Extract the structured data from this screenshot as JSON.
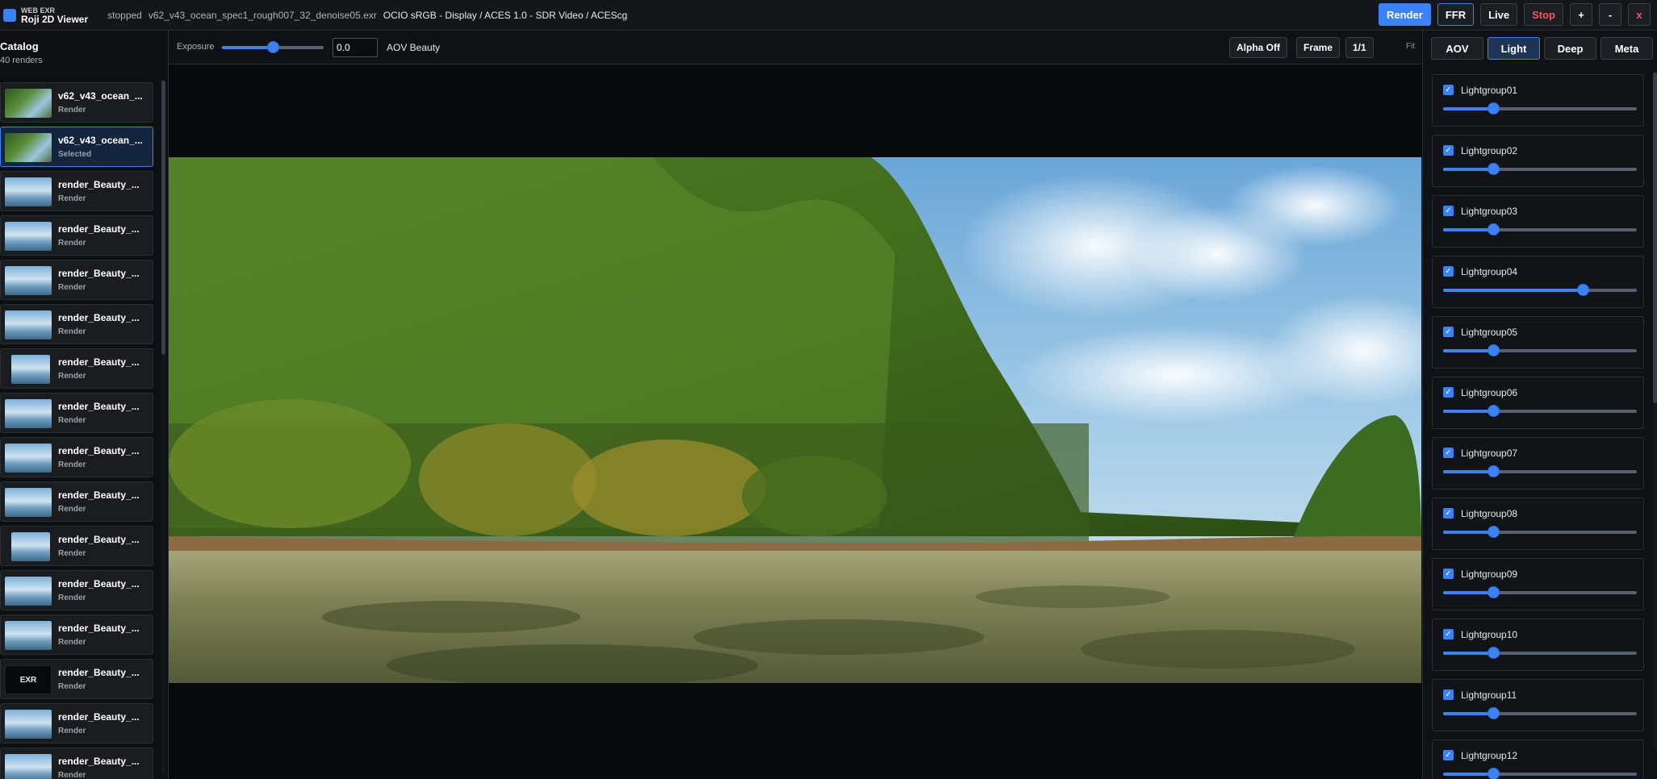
{
  "app": {
    "brand_small": "WEB EXR",
    "brand_title": "Roji 2D Viewer",
    "status": "stopped",
    "filename": "v62_v43_ocean_spec1_rough007_32_denoise05.exr",
    "ocio": "OCIO sRGB - Display / ACES 1.0 - SDR Video / ACEScg",
    "accent_color": "#3b82f6",
    "stop_color": "#f05a5a"
  },
  "top_buttons": {
    "render": "Render",
    "ffr": "FFR",
    "live": "Live",
    "stop": "Stop",
    "plus": "+",
    "minus": "-",
    "close": "x"
  },
  "catalog": {
    "title": "Catalog",
    "count": "40 renders",
    "items": [
      {
        "title": "v62_v43_ocean_...",
        "sub": "Render",
        "thumb": "jungle"
      },
      {
        "title": "v62_v43_ocean_...",
        "sub": "Selected",
        "thumb": "jungle"
      },
      {
        "title": "render_Beauty_...",
        "sub": "Render",
        "thumb": "sky"
      },
      {
        "title": "render_Beauty_...",
        "sub": "Render",
        "thumb": "sky"
      },
      {
        "title": "render_Beauty_...",
        "sub": "Render",
        "thumb": "sky"
      },
      {
        "title": "render_Beauty_...",
        "sub": "Render",
        "thumb": "sky"
      },
      {
        "title": "render_Beauty_...",
        "sub": "Render",
        "thumb": "sky"
      },
      {
        "title": "render_Beauty_...",
        "sub": "Render",
        "thumb": "sky"
      },
      {
        "title": "render_Beauty_...",
        "sub": "Render",
        "thumb": "sky"
      },
      {
        "title": "render_Beauty_...",
        "sub": "Render",
        "thumb": "sky"
      },
      {
        "title": "render_Beauty_...",
        "sub": "Render",
        "thumb": "sky"
      },
      {
        "title": "render_Beauty_...",
        "sub": "Render",
        "thumb": "sky"
      },
      {
        "title": "render_Beauty_...",
        "sub": "Render",
        "thumb": "sky"
      },
      {
        "title": "render_Beauty_...",
        "sub": "Render",
        "thumb": "exr",
        "thumb_text": "EXR"
      },
      {
        "title": "render_Beauty_...",
        "sub": "Render",
        "thumb": "sky"
      },
      {
        "title": "render_Beauty_...",
        "sub": "Render",
        "thumb": "sky"
      }
    ]
  },
  "viewer": {
    "exposure_label": "Exposure",
    "exposure_value": "0.0",
    "exposure_slider_fraction": 0.5,
    "aov_label": "AOV Beauty",
    "alpha_button": "Alpha Off",
    "frame_button": "Frame",
    "ratio_button": "1/1",
    "fit_label": "Fit"
  },
  "panel": {
    "tabs": [
      "AOV",
      "Light",
      "Deep",
      "Meta"
    ],
    "active_tab": "Light",
    "lightgroups": [
      {
        "name": "Lightgroup01",
        "checked": true,
        "level": 0.26
      },
      {
        "name": "Lightgroup02",
        "checked": true,
        "level": 0.26
      },
      {
        "name": "Lightgroup03",
        "checked": true,
        "level": 0.26
      },
      {
        "name": "Lightgroup04",
        "checked": true,
        "level": 0.72
      },
      {
        "name": "Lightgroup05",
        "checked": true,
        "level": 0.26
      },
      {
        "name": "Lightgroup06",
        "checked": true,
        "level": 0.26
      },
      {
        "name": "Lightgroup07",
        "checked": true,
        "level": 0.26
      },
      {
        "name": "Lightgroup08",
        "checked": true,
        "level": 0.26
      },
      {
        "name": "Lightgroup09",
        "checked": true,
        "level": 0.26
      },
      {
        "name": "Lightgroup10",
        "checked": true,
        "level": 0.26
      },
      {
        "name": "Lightgroup11",
        "checked": true,
        "level": 0.26
      },
      {
        "name": "Lightgroup12",
        "checked": true,
        "level": 0.26
      }
    ]
  }
}
